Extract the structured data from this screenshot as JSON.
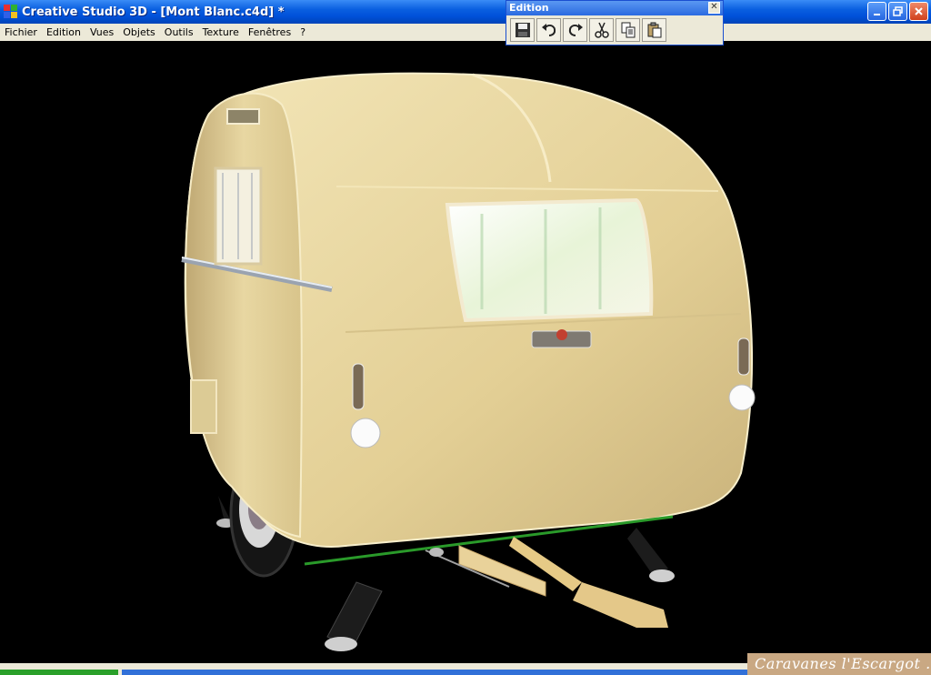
{
  "window": {
    "title": "Creative Studio 3D - [Mont Blanc.c4d] *",
    "buttons": [
      "minimize-icon",
      "restore-icon",
      "close-icon"
    ]
  },
  "menu": {
    "items": [
      "Fichier",
      "Edition",
      "Vues",
      "Objets",
      "Outils",
      "Texture",
      "Fenêtres",
      "?"
    ]
  },
  "toolbar": {
    "title": "Edition",
    "close_glyph": "✕",
    "buttons": [
      "save-icon",
      "undo-icon",
      "redo-icon",
      "cut-icon",
      "copy-icon",
      "paste-icon"
    ]
  },
  "watermark": {
    "text": "Caravanes l'Escargot ."
  },
  "colors": {
    "titlebar": "#0050d8",
    "menubar": "#ece9d8",
    "viewport_bg": "#000000",
    "caravan_body": "#e8d7a0",
    "watermark_bg": "#c9a883"
  }
}
